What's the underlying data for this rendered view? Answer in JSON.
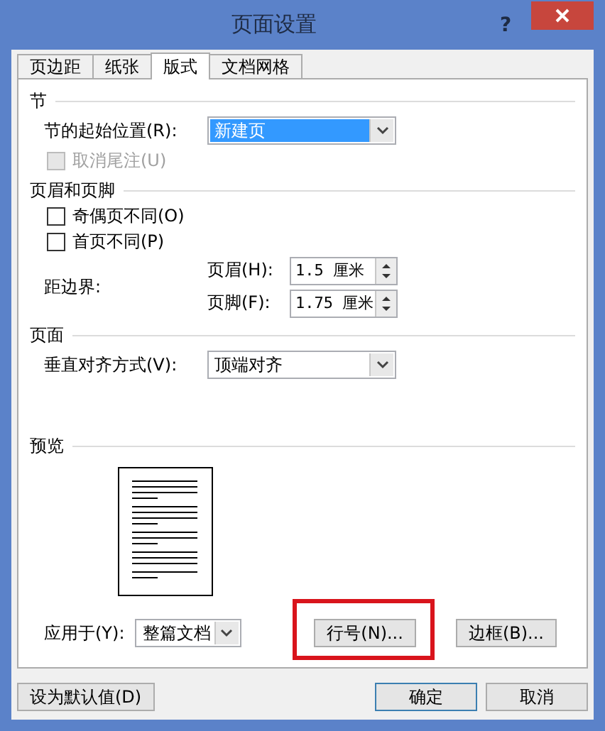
{
  "window": {
    "title": "页面设置",
    "help": "?"
  },
  "tabs": [
    {
      "label": "页边距",
      "selected": false
    },
    {
      "label": "纸张",
      "selected": false
    },
    {
      "label": "版式",
      "selected": true
    },
    {
      "label": "文档网格",
      "selected": false
    }
  ],
  "section_start": {
    "heading": "节",
    "label": "节的起始位置(R):",
    "value": "新建页",
    "focused": true
  },
  "endnotes": {
    "label": "取消尾注(U)",
    "checked": false,
    "disabled": true
  },
  "headers_footers": {
    "heading": "页眉和页脚",
    "options": [
      {
        "label": "奇偶页不同(O)",
        "checked": false
      },
      {
        "label": "首页不同(P)",
        "checked": false
      }
    ],
    "from_edge_label": "距边界:",
    "spinners": [
      {
        "label": "页眉(H):",
        "value": "1.5 厘米"
      },
      {
        "label": "页脚(F):",
        "value": "1.75 厘米"
      }
    ]
  },
  "page": {
    "heading": "页面",
    "label": "垂直对齐方式(V):",
    "value": "顶端对齐",
    "focused": false
  },
  "preview": {
    "heading": "预览",
    "apply_label": "应用于(Y):",
    "apply_value": "整篇文档",
    "buttons": [
      {
        "label": "行号(N)...",
        "highlighted": true
      },
      {
        "label": "边框(B)...",
        "highlighted": false
      }
    ]
  },
  "footer": {
    "default_button": "设为默认值(D)",
    "buttons": [
      {
        "label": "确定",
        "default": true
      },
      {
        "label": "取消",
        "default": false
      }
    ]
  }
}
